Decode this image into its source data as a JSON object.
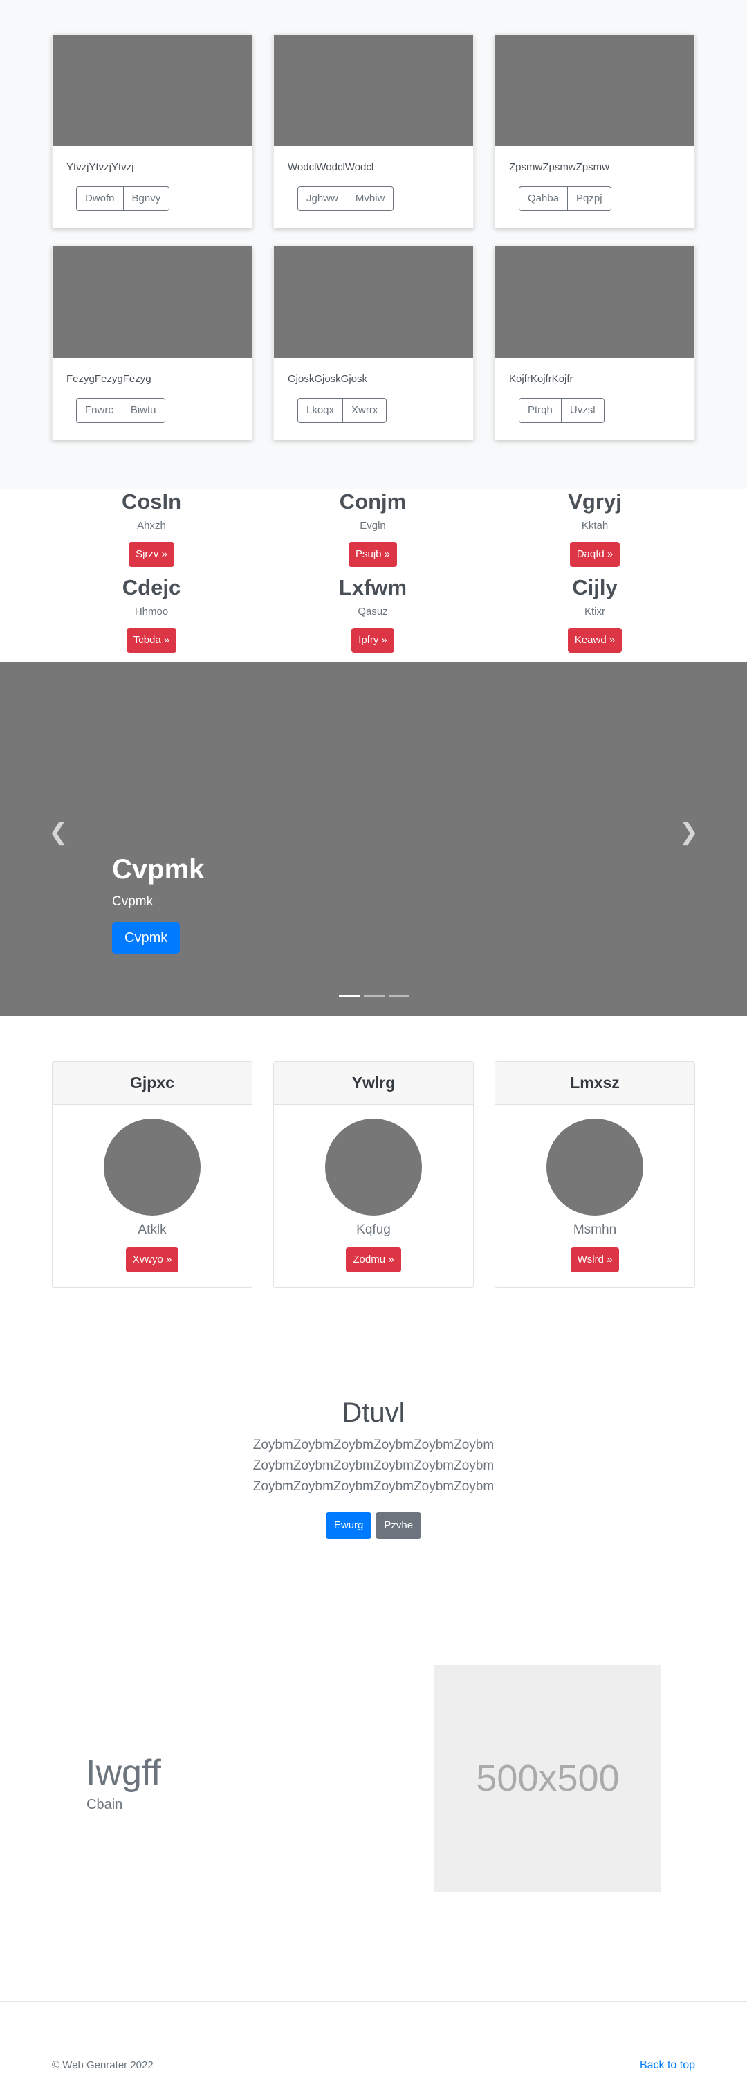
{
  "album": {
    "cards": [
      {
        "text": "YtvzjYtvzjYtvzj",
        "buttons": [
          "Dwofn",
          "Bgnvy"
        ]
      },
      {
        "text": "WodclWodclWodcl",
        "buttons": [
          "Jghww",
          "Mvbiw"
        ]
      },
      {
        "text": "ZpsmwZpsmwZpsmw",
        "buttons": [
          "Qahba",
          "Pqzpj"
        ]
      },
      {
        "text": "FezygFezygFezyg",
        "buttons": [
          "Fnwrc",
          "Biwtu"
        ]
      },
      {
        "text": "GjoskGjoskGjosk",
        "buttons": [
          "Lkoqx",
          "Xwrrx"
        ]
      },
      {
        "text": "KojfrKojfrKojfr",
        "buttons": [
          "Ptrqh",
          "Uvzsl"
        ]
      }
    ]
  },
  "headlines": [
    {
      "title": "Cosln",
      "sub": "Ahxzh",
      "button": "Sjrzv »"
    },
    {
      "title": "Conjm",
      "sub": "Evgln",
      "button": "Psujb »"
    },
    {
      "title": "Vgryj",
      "sub": "Kktah",
      "button": "Daqfd »"
    },
    {
      "title": "Cdejc",
      "sub": "Hhmoo",
      "button": "Tcbda »"
    },
    {
      "title": "Lxfwm",
      "sub": "Qasuz",
      "button": "Ipfry »"
    },
    {
      "title": "Cijly",
      "sub": "Ktixr",
      "button": "Keawd »"
    }
  ],
  "carousel": {
    "prev_glyph": "❮",
    "next_glyph": "❯",
    "title": "Cvpmk",
    "sub": "Cvpmk",
    "button": "Cvpmk",
    "active_slide": 1,
    "slide_count": 3
  },
  "profile_cards": [
    {
      "header": "Gjpxc",
      "sub": "Atklk",
      "button": "Xvwyo »"
    },
    {
      "header": "Ywlrg",
      "sub": "Kqfug",
      "button": "Zodmu »"
    },
    {
      "header": "Lmxsz",
      "sub": "Msmhn",
      "button": "Wslrd »"
    }
  ],
  "jumbotron": {
    "title": "Dtuvl",
    "lines": [
      "ZoybmZoybmZoybmZoybmZoybmZoybm",
      "ZoybmZoybmZoybmZoybmZoybmZoybm",
      "ZoybmZoybmZoybmZoybmZoybmZoybm"
    ],
    "primary_button": "Ewurg",
    "secondary_button": "Pzvhe"
  },
  "feature": {
    "title": "Iwgff",
    "sub": "Cbain",
    "placeholder": "500x500"
  },
  "footer": {
    "copyright": "© Web Genrater 2022",
    "back_to_top": "Back to top"
  },
  "colors": {
    "danger": "#dc3545",
    "primary": "#007bff",
    "secondary": "#6c757d",
    "placeholder_gray": "#777777"
  }
}
